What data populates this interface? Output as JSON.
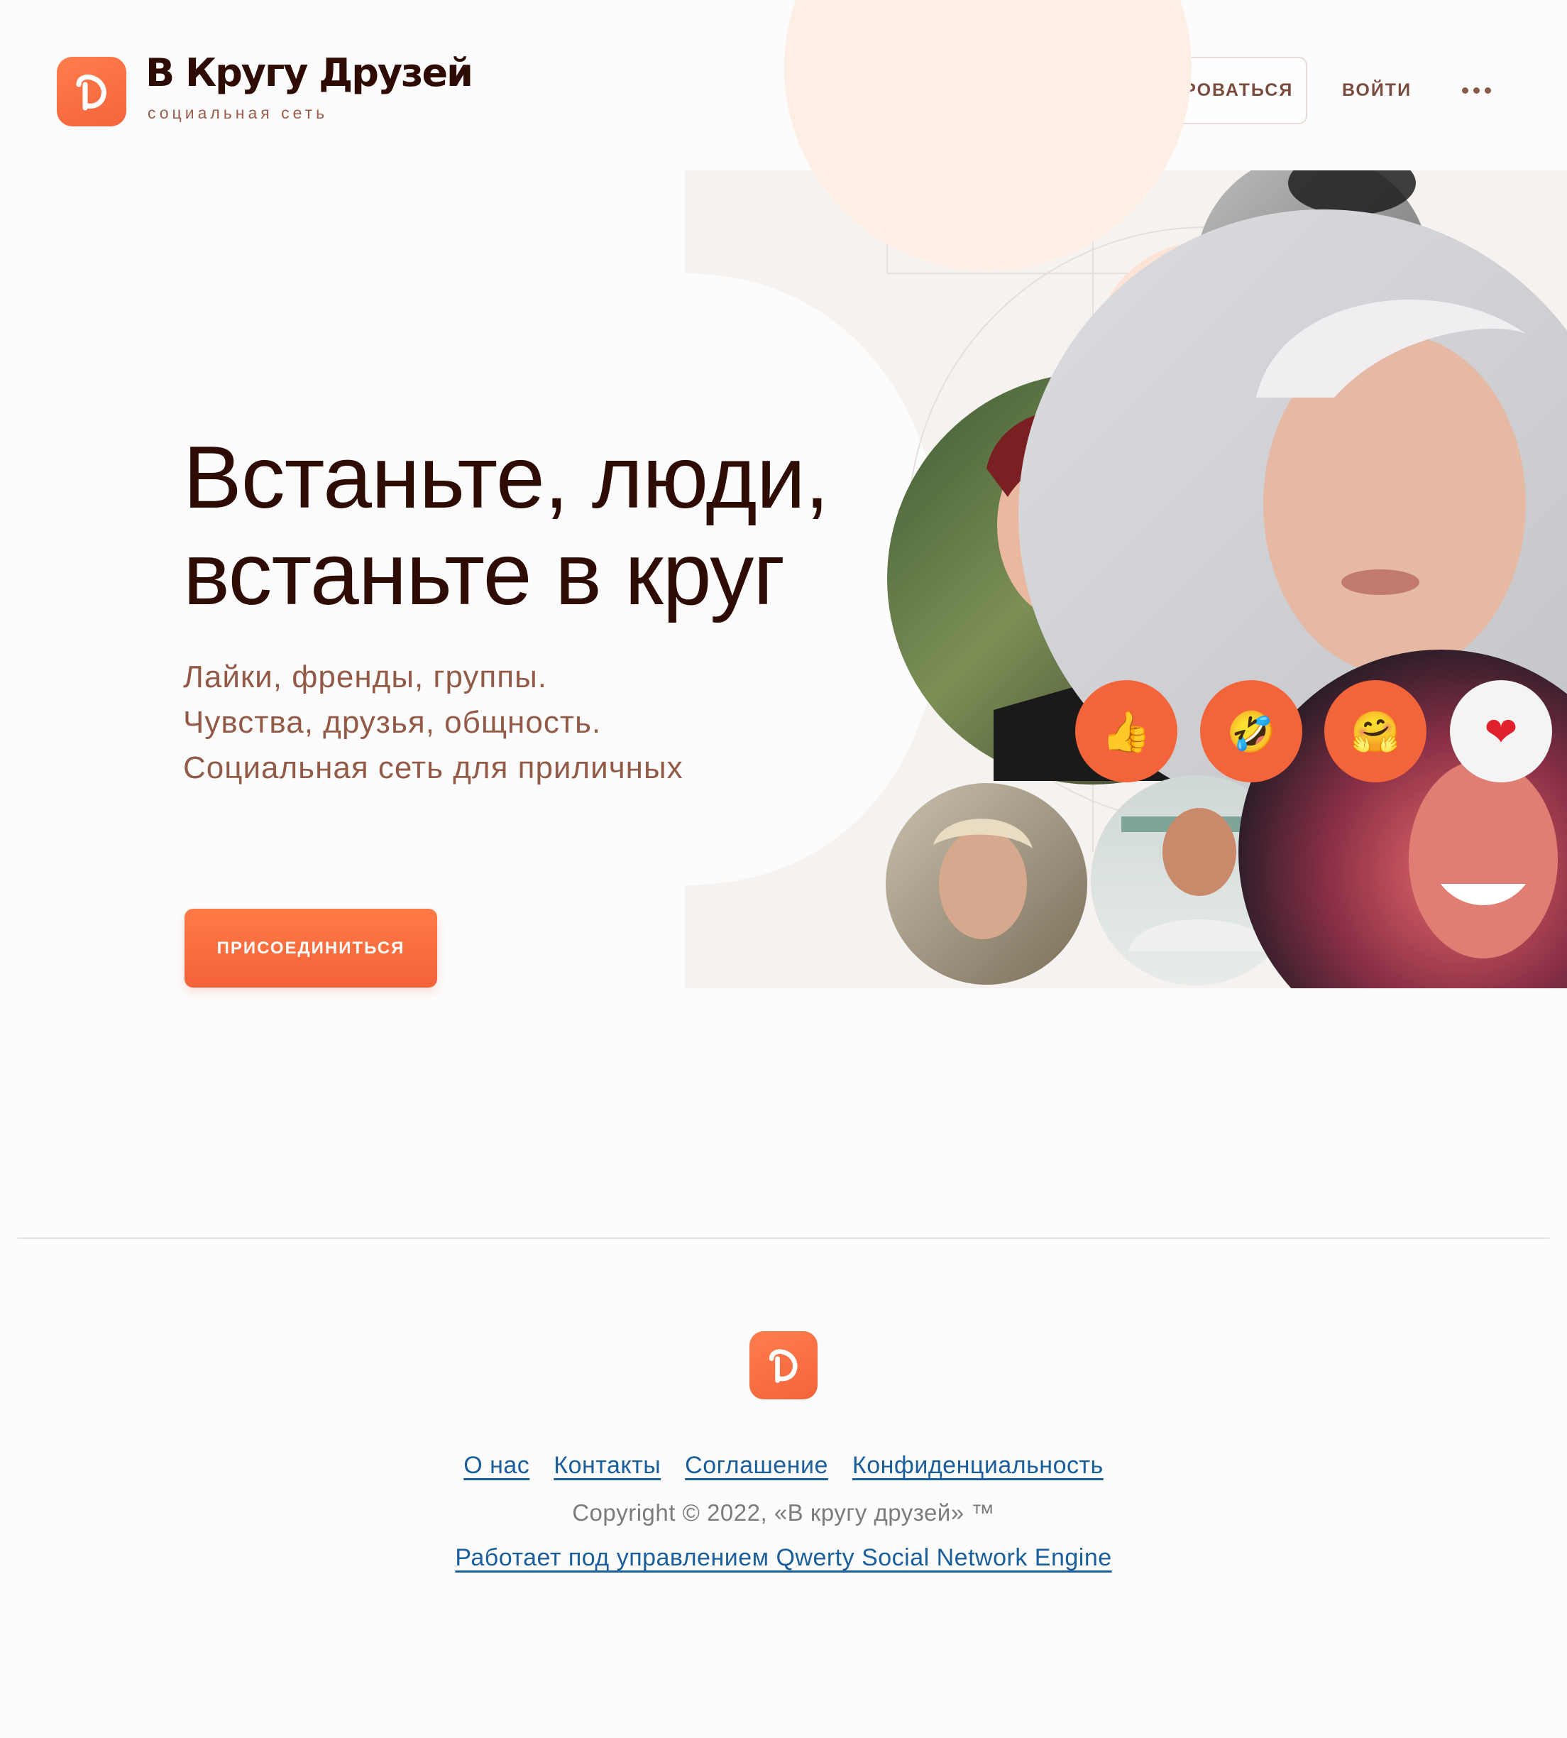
{
  "header": {
    "brand_name": "В Кругу Друзей",
    "brand_tagline": "социальная сеть",
    "register_label": "ЗАРЕГИСТРИРОВАТЬСЯ",
    "login_label": "ВОЙТИ",
    "more_icon": "more-dots-icon"
  },
  "hero": {
    "title_lines": [
      "Встаньте, люди,",
      "встаньте в круг"
    ],
    "subtitle_lines": [
      "Лайки, френды, группы.",
      "Чувства, друзья, общность.",
      "Социальная сеть для приличных"
    ],
    "join_label": "ПРИСОЕДИНИТЬСЯ",
    "reactions": [
      {
        "name": "thumbs-up-icon",
        "glyph": "👍"
      },
      {
        "name": "rofl-icon",
        "glyph": "🤣"
      },
      {
        "name": "hugging-face-icon",
        "glyph": "🤗"
      },
      {
        "name": "heart-icon",
        "glyph": "❤️"
      }
    ]
  },
  "footer": {
    "links": [
      "О нас",
      "Контакты",
      "Соглашение",
      "Конфиденциальность"
    ],
    "copyright": "Copyright © 2022, «В кругу друзей» ™",
    "powered_by": "Работает под управлением Qwerty Social Network Engine"
  },
  "colors": {
    "accent": "#f4643a",
    "text_dark": "#2e0c04",
    "text_muted": "#935a48",
    "link": "#1a5e9c",
    "peach": "#fdeee6"
  }
}
